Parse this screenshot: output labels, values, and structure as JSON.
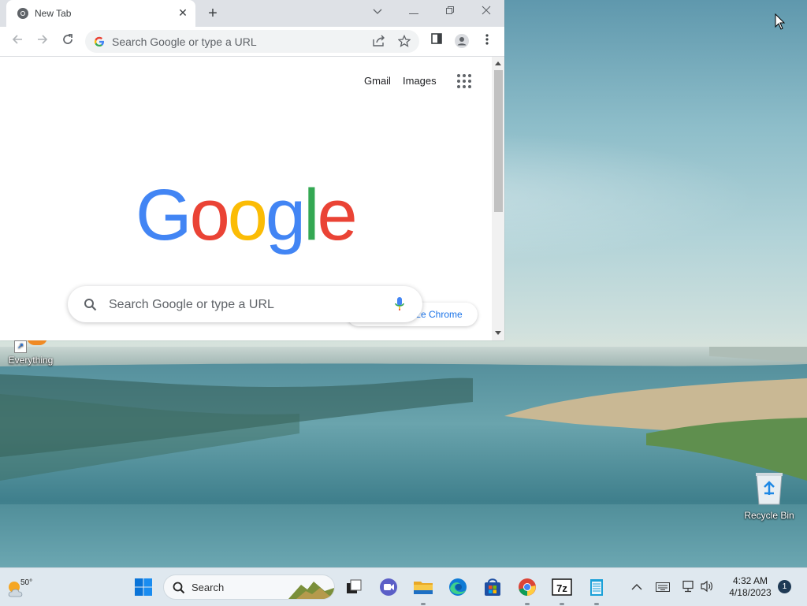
{
  "browser": {
    "tab_title": "New Tab",
    "omnibox_placeholder": "Search Google or type a URL",
    "header_links": [
      "Gmail",
      "Images"
    ],
    "logo_text": "Google",
    "search_placeholder": "Search Google or type a URL",
    "customize_label": "ze Chrome"
  },
  "desktop": {
    "icons": [
      {
        "label": "Everything"
      },
      {
        "label": "Recycle Bin"
      }
    ]
  },
  "taskbar": {
    "weather_temp": "50°",
    "search_label": "Search",
    "clock_time": "4:32 AM",
    "clock_date": "4/18/2023",
    "notification_count": "1",
    "pinned_apps": [
      "task-view",
      "meet",
      "file-explorer",
      "edge",
      "microsoft-store",
      "chrome",
      "7-zip",
      "notepad"
    ]
  },
  "colors": {
    "google_blue": "#4285F4",
    "google_red": "#EA4335",
    "google_yellow": "#FBBC05",
    "google_green": "#34A853",
    "taskbar_bg": "#dfe8ef"
  }
}
